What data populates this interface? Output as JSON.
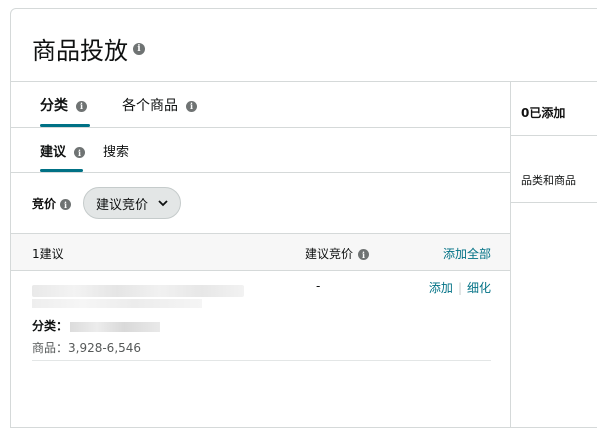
{
  "header": {
    "title": "商品投放",
    "info_glyph": "i"
  },
  "tabs": [
    {
      "label": "分类",
      "active": true
    },
    {
      "label": "各个商品",
      "active": false
    }
  ],
  "subtabs": [
    {
      "label": "建议",
      "active": true
    },
    {
      "label": "搜索",
      "active": false
    }
  ],
  "bid": {
    "label": "竞价",
    "dropdown_value": "建议竞价"
  },
  "table": {
    "col_suggestion": "1建议",
    "col_bid": "建议竞价",
    "add_all": "添加全部"
  },
  "row": {
    "category_label": "分类：",
    "products_text": "商品：3,928-6,546",
    "suggested_bid": "-",
    "action_add": "添加",
    "action_refine": "细化"
  },
  "right_panel": {
    "title": "0已添加",
    "subtitle": "品类和商品"
  },
  "colors": {
    "accent": "#007185",
    "border": "#d5d9d9",
    "pill_bg": "#e3e6e6"
  },
  "icons": {
    "info": "info-icon",
    "dropdown": "chevron-down-icon"
  }
}
